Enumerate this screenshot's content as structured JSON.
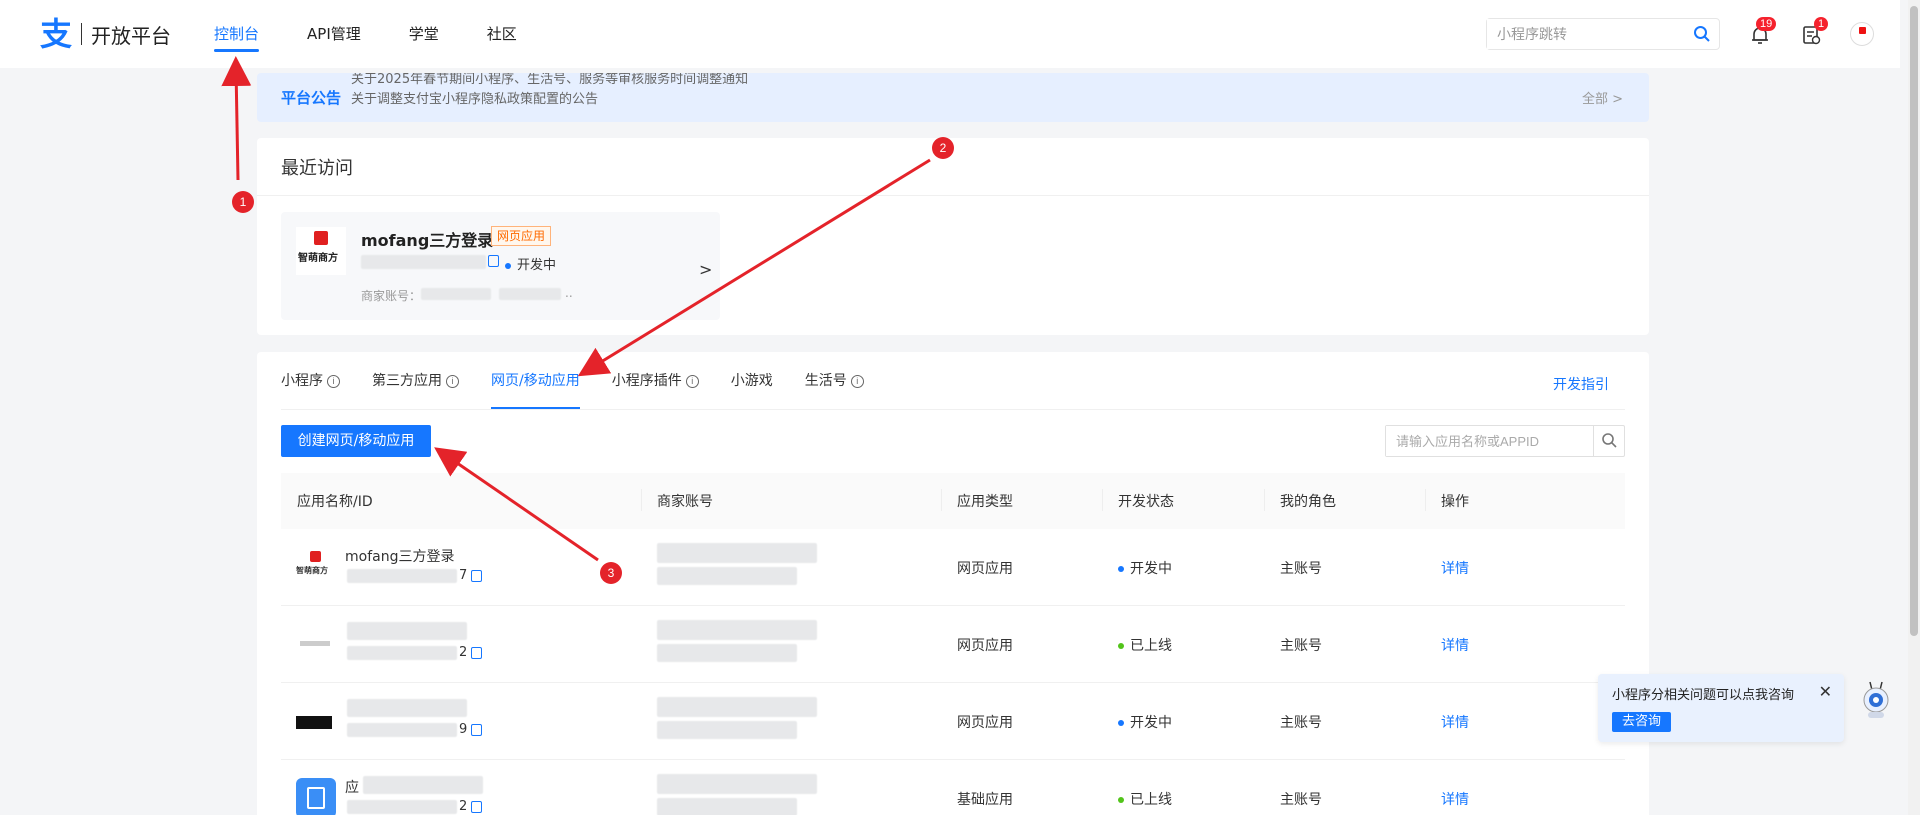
{
  "header": {
    "logo_mark": "支",
    "logo_text": "开放平台",
    "nav": [
      "控制台",
      "API管理",
      "学堂",
      "社区"
    ],
    "search_placeholder": "小程序跳转",
    "bell_count": "19",
    "task_count": "1"
  },
  "notice": {
    "title": "平台公告",
    "line1": "关于2025年春节期间小程序、生活号、服务等审核服务时间调整通知",
    "line2": "关于调整支付宝小程序隐私政策配置的公告",
    "all_label": "全部 >"
  },
  "recent": {
    "title": "最近访问",
    "app_logo_text": "智萌商方",
    "app_name": "mofang三方登录",
    "tag": "网页应用",
    "status": "开发中",
    "merchant_label": "商家账号：",
    "merchant_suffix": "..",
    "arrow": ">"
  },
  "tabs": {
    "items": [
      "小程序",
      "第三方应用",
      "网页/移动应用",
      "小程序插件",
      "小游戏",
      "生活号"
    ],
    "guide": "开发指引",
    "create_button": "创建网页/移动应用",
    "search_placeholder": "请输入应用名称或APPID"
  },
  "table": {
    "headers": [
      "应用名称/ID",
      "商家账号",
      "应用类型",
      "开发状态",
      "我的角色",
      "操作"
    ],
    "rows": [
      {
        "name": "mofang三方登录",
        "id_tail": "7",
        "type": "网页应用",
        "status": "开发中",
        "status_color": "#1677ff",
        "role": "主账号",
        "action": "详情"
      },
      {
        "name": "",
        "id_tail": "2",
        "type": "网页应用",
        "status": "已上线",
        "status_color": "#52c41a",
        "role": "主账号",
        "action": "详情"
      },
      {
        "name": "",
        "id_tail": "9",
        "type": "网页应用",
        "status": "开发中",
        "status_color": "#1677ff",
        "role": "主账号",
        "action": "详情"
      },
      {
        "name": "应",
        "id_tail": "2",
        "type": "基础应用",
        "status": "已上线",
        "status_color": "#52c41a",
        "role": "主账号",
        "action": "详情"
      }
    ]
  },
  "annotations": [
    "1",
    "2",
    "3"
  ],
  "chat": {
    "text": "小程序分相关问题可以点我咨询",
    "button": "去咨询",
    "close": "✕"
  },
  "colors": {
    "accent": "#1677ff",
    "annotation": "#e4232a"
  }
}
